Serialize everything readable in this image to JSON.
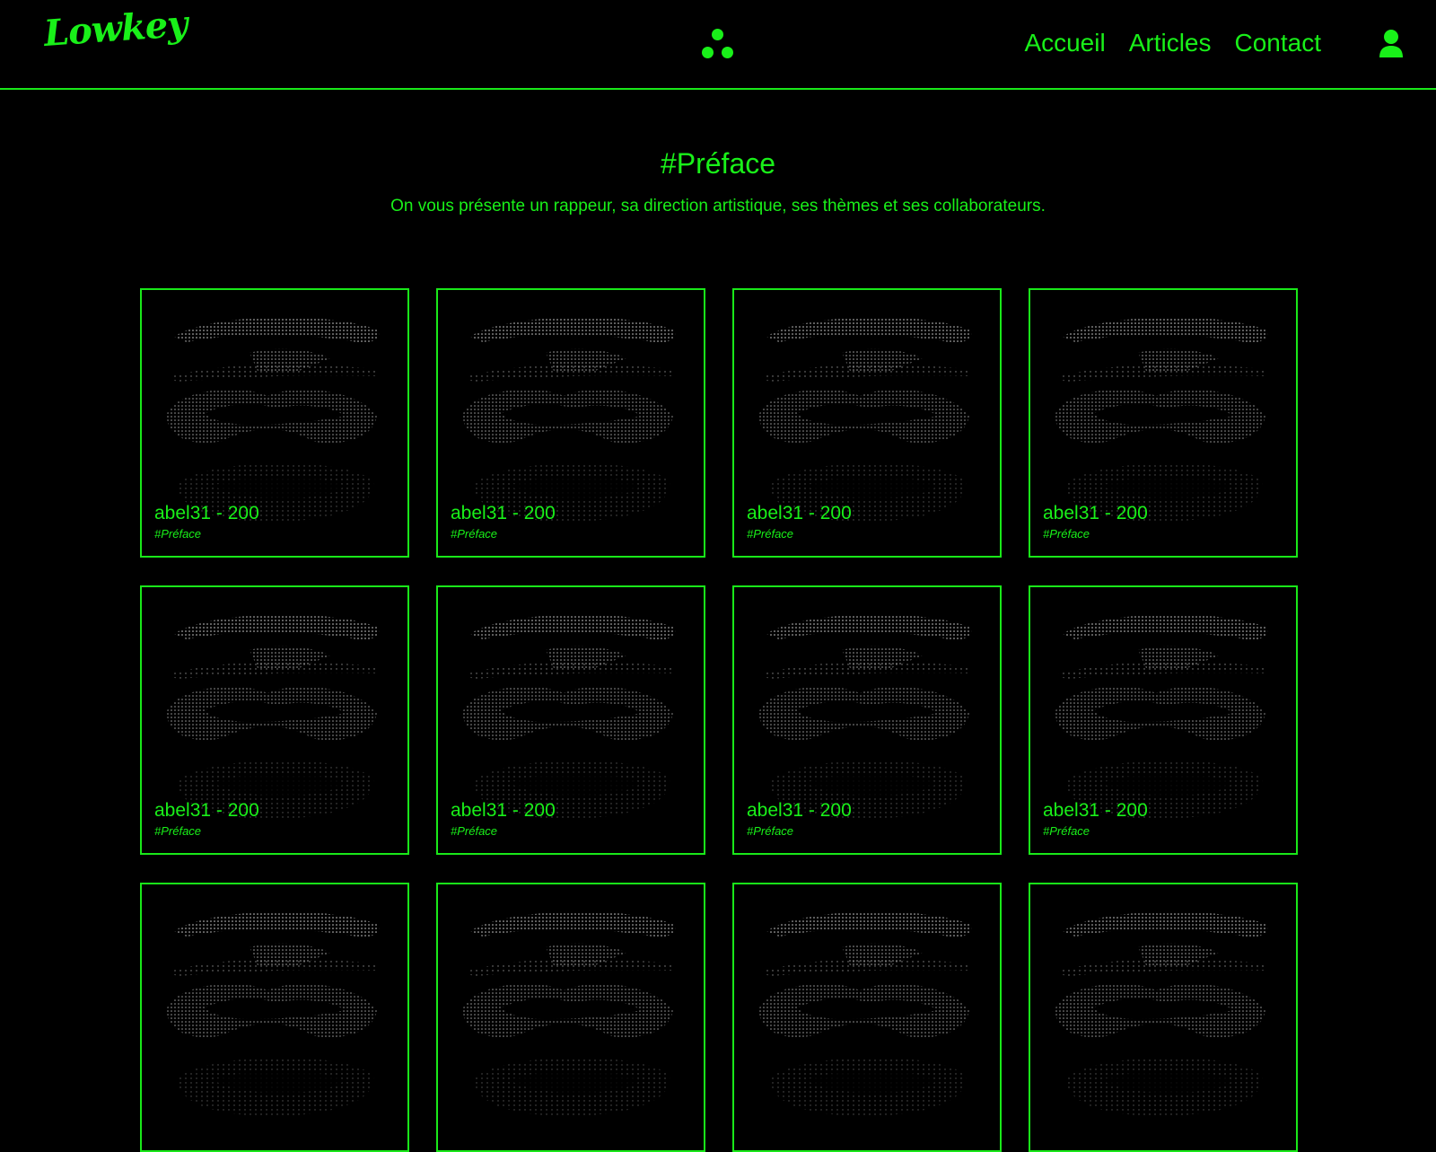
{
  "header": {
    "logo": "Lowkey",
    "nav": [
      {
        "label": "Accueil"
      },
      {
        "label": "Articles"
      },
      {
        "label": "Contact"
      }
    ]
  },
  "hero": {
    "title": "#Préface",
    "subtitle": "On vous présente un rappeur, sa direction artistique, ses thèmes et ses collaborateurs."
  },
  "cards": [
    {
      "title": "abel31 - 200",
      "tag": "#Préface"
    },
    {
      "title": "abel31 - 200",
      "tag": "#Préface"
    },
    {
      "title": "abel31 - 200",
      "tag": "#Préface"
    },
    {
      "title": "abel31 - 200",
      "tag": "#Préface"
    },
    {
      "title": "abel31 - 200",
      "tag": "#Préface"
    },
    {
      "title": "abel31 - 200",
      "tag": "#Préface"
    },
    {
      "title": "abel31 - 200",
      "tag": "#Préface"
    },
    {
      "title": "abel31 - 200",
      "tag": "#Préface"
    },
    {
      "title": "",
      "tag": ""
    },
    {
      "title": "",
      "tag": ""
    },
    {
      "title": "",
      "tag": ""
    },
    {
      "title": "",
      "tag": ""
    }
  ],
  "colors": {
    "accent": "#19f019",
    "background": "#000000",
    "art": "#d9d9d9"
  },
  "icons": {
    "center": "three-dots-icon",
    "user": "user-icon"
  }
}
